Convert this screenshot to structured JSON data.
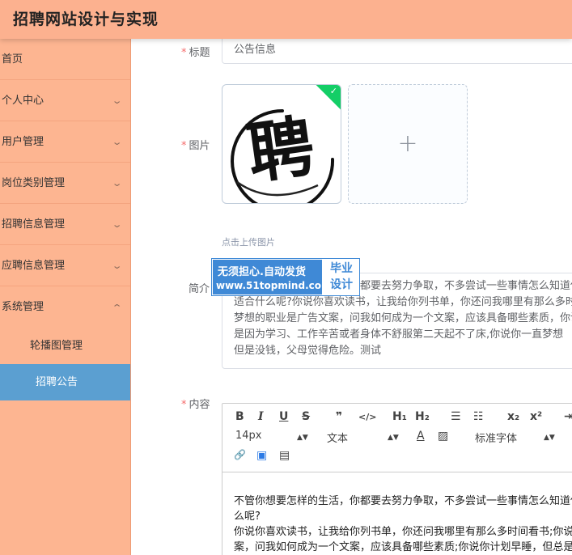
{
  "header": {
    "title": "招聘网站设计与实现"
  },
  "sidebar": {
    "items": [
      {
        "label": "首页",
        "has_children": false
      },
      {
        "label": "个人中心",
        "has_children": true
      },
      {
        "label": "用户管理",
        "has_children": true
      },
      {
        "label": "岗位类别管理",
        "has_children": true
      },
      {
        "label": "招聘信息管理",
        "has_children": true
      },
      {
        "label": "应聘信息管理",
        "has_children": true
      },
      {
        "label": "系统管理",
        "has_children": true,
        "expanded": true
      }
    ],
    "chevron": "⌄",
    "subitems": [
      {
        "label": "轮播图管理",
        "active": false
      },
      {
        "label": "招聘公告",
        "active": true
      }
    ],
    "active_color": "#5b9fd1"
  },
  "form": {
    "title": {
      "label": "标题",
      "required_mark": "*",
      "value": "公告信息"
    },
    "image": {
      "label": "图片",
      "required_mark": "*",
      "upload_tip": "点击上传图片",
      "uploaded_glyph": "聘",
      "add_icon": "+"
    },
    "intro": {
      "label": "简介",
      "lines": [
        "不管你想要怎样的生活，你都要去努力争取，不多尝试一些事情怎么知道你",
        "适合什么呢?你说你喜欢读书，让我给你列书单，你还问我哪里有那么多时间",
        "梦想的职业是广告文案，问我如何成为一个文案，应该具备哪些素质，你说",
        "是因为学习、工作辛苦或者身体不舒服第二天起不了床,你说你一直梦想",
        "但是没钱，父母觉得危险。测试"
      ]
    },
    "content": {
      "label": "内容",
      "required_mark": "*",
      "toolbar": {
        "bold": "B",
        "italic": "I",
        "underline": "U",
        "strike": "S",
        "quote": "❞",
        "code": "</>",
        "h1": "H₁",
        "h2": "H₂",
        "ordered_list": "☰",
        "bullet_list": "☷",
        "subscript": "x₂",
        "superscript": "x²",
        "indent": "⇥",
        "font_size": "14px",
        "text_type": "文本",
        "font_color": "A",
        "bg_color": "▨",
        "font_family": "标准字体",
        "link": "🔗",
        "image": "▣",
        "video": "▤"
      },
      "body_lines": [
        "不管你想要怎样的生活，你都要去努力争取，不多尝试一些事情怎么知道你适合什",
        "么呢?",
        "你说你喜欢读书，让我给你列书单，你还问我哪里有那么多时间看书;你说",
        "案，问我如何成为一个文案，应该具备哪些素质;你说你计划早睡，但总是"
      ]
    }
  },
  "watermark": {
    "line1": "无须担心.自动发货",
    "line2": "www.51topmind.com",
    "right1": "毕业",
    "right2": "设计"
  }
}
